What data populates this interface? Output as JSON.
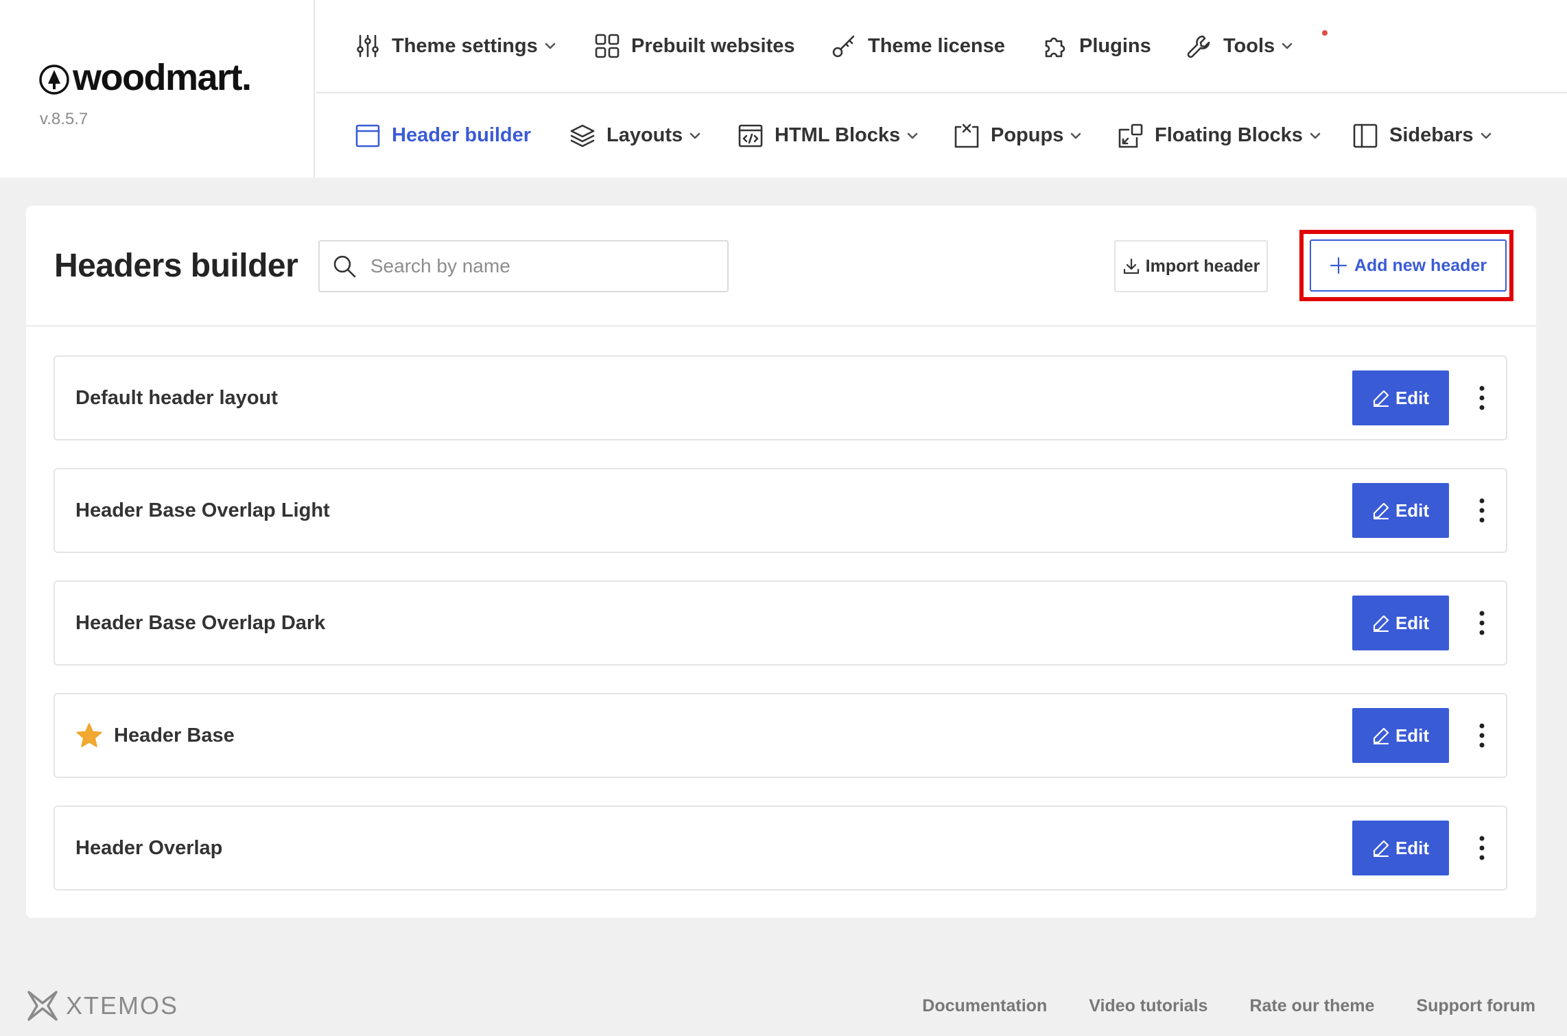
{
  "brand": {
    "name": "woodmart.",
    "version": "v.8.5.7"
  },
  "nav_top": [
    {
      "label": "Theme settings",
      "icon": "sliders-icon",
      "dropdown": true
    },
    {
      "label": "Prebuilt websites",
      "icon": "grid-icon",
      "dropdown": false
    },
    {
      "label": "Theme license",
      "icon": "key-icon",
      "dropdown": false,
      "notification_dot": true
    },
    {
      "label": "Plugins",
      "icon": "puzzle-icon",
      "dropdown": false
    },
    {
      "label": "Tools",
      "icon": "wrench-icon",
      "dropdown": true
    }
  ],
  "nav_bottom": [
    {
      "label": "Header builder",
      "icon": "header-layout-icon",
      "dropdown": false,
      "active": true
    },
    {
      "label": "Layouts",
      "icon": "layers-icon",
      "dropdown": true
    },
    {
      "label": "HTML Blocks",
      "icon": "code-block-icon",
      "dropdown": true
    },
    {
      "label": "Popups",
      "icon": "popup-icon",
      "dropdown": true
    },
    {
      "label": "Floating Blocks",
      "icon": "floating-block-icon",
      "dropdown": true
    },
    {
      "label": "Sidebars",
      "icon": "sidebar-icon",
      "dropdown": true
    }
  ],
  "main": {
    "title": "Headers builder",
    "search": {
      "placeholder": "Search by name",
      "value": ""
    },
    "import_label": "Import header",
    "add_label": "Add new header",
    "edit_label": "Edit",
    "headers": [
      {
        "name": "Default header layout",
        "is_default": false
      },
      {
        "name": "Header Base Overlap Light",
        "is_default": false
      },
      {
        "name": "Header Base Overlap Dark",
        "is_default": false
      },
      {
        "name": "Header Base",
        "is_default": true
      },
      {
        "name": "Header Overlap",
        "is_default": false
      }
    ]
  },
  "footer": {
    "brand": "XTEMOS",
    "links": [
      "Documentation",
      "Video tutorials",
      "Rate our theme",
      "Support forum"
    ]
  },
  "colors": {
    "accent": "#3a5bd6",
    "highlight": "#e00000",
    "star": "#f0a830",
    "page_bg": "#f0f0f0",
    "notification_dot": "#e14d43"
  }
}
